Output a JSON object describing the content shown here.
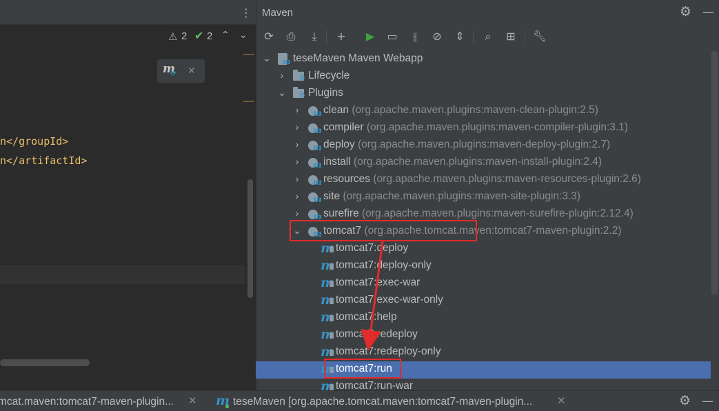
{
  "editor": {
    "warnings_count": "2",
    "checks_count": "2",
    "code_lines": [
      "n</groupId>",
      "n</artifactId>"
    ],
    "icons": [
      "more-vertical-icon",
      "warning-icon",
      "check-icon",
      "chevron-up-icon",
      "chevron-down-icon",
      "maven-reload-icon",
      "close-icon"
    ]
  },
  "maven": {
    "title": "Maven",
    "toolbar_icons": [
      "reload-all-icon",
      "add-sources-icon",
      "download-icon",
      "add-project-icon",
      "run-icon",
      "execute-goal-icon",
      "toggle-offline-icon",
      "skip-tests-icon",
      "collapse-all-icon",
      "analyze-dependencies-icon",
      "show-diagram-icon",
      "settings-wrench-icon"
    ],
    "tree": [
      {
        "label": "teseMaven Maven Webapp",
        "coord": "",
        "arrow": "⌄",
        "icon": "project"
      },
      {
        "label": "Lifecycle",
        "coord": "",
        "arrow": "›",
        "icon": "folder"
      },
      {
        "label": "Plugins",
        "coord": "",
        "arrow": "⌄",
        "icon": "folder"
      },
      {
        "label": "clean",
        "coord": "(org.apache.maven.plugins:maven-clean-plugin:2.5)",
        "arrow": "›",
        "icon": "plugin"
      },
      {
        "label": "compiler",
        "coord": "(org.apache.maven.plugins:maven-compiler-plugin:3.1)",
        "arrow": "›",
        "icon": "plugin"
      },
      {
        "label": "deploy",
        "coord": "(org.apache.maven.plugins:maven-deploy-plugin:2.7)",
        "arrow": "›",
        "icon": "plugin"
      },
      {
        "label": "install",
        "coord": "(org.apache.maven.plugins:maven-install-plugin:2.4)",
        "arrow": "›",
        "icon": "plugin"
      },
      {
        "label": "resources",
        "coord": "(org.apache.maven.plugins:maven-resources-plugin:2.6)",
        "arrow": "›",
        "icon": "plugin"
      },
      {
        "label": "site",
        "coord": "(org.apache.maven.plugins:maven-site-plugin:3.3)",
        "arrow": "›",
        "icon": "plugin"
      },
      {
        "label": "surefire",
        "coord": "(org.apache.maven.plugins:maven-surefire-plugin:2.12.4)",
        "arrow": "›",
        "icon": "plugin"
      },
      {
        "label": "tomcat7",
        "coord": "(org.apache.tomcat.maven:tomcat7-maven-plugin:2.2)",
        "arrow": "⌄",
        "icon": "plugin"
      },
      {
        "label": "tomcat7:deploy",
        "coord": "",
        "arrow": "",
        "icon": "goal"
      },
      {
        "label": "tomcat7:deploy-only",
        "coord": "",
        "arrow": "",
        "icon": "goal"
      },
      {
        "label": "tomcat7:exec-war",
        "coord": "",
        "arrow": "",
        "icon": "goal"
      },
      {
        "label": "tomcat7:exec-war-only",
        "coord": "",
        "arrow": "",
        "icon": "goal"
      },
      {
        "label": "tomcat7:help",
        "coord": "",
        "arrow": "",
        "icon": "goal"
      },
      {
        "label": "tomcat7:redeploy",
        "coord": "",
        "arrow": "",
        "icon": "goal"
      },
      {
        "label": "tomcat7:redeploy-only",
        "coord": "",
        "arrow": "",
        "icon": "goal"
      },
      {
        "label": "tomcat7:run",
        "coord": "",
        "arrow": "",
        "icon": "goal",
        "selected": true
      },
      {
        "label": "tomcat7:run-war",
        "coord": "",
        "arrow": "",
        "icon": "goal"
      }
    ]
  },
  "run_tabs": [
    {
      "label": "mcat.maven:tomcat7-maven-plugin..."
    },
    {
      "label": "teseMaven [org.apache.tomcat.maven:tomcat7-maven-plugin..."
    }
  ],
  "colors": {
    "selection": "#4b6eaf",
    "annotation_red": "#e32b2b",
    "maven_blue": "#3592c4",
    "run_green": "#3fa33f"
  }
}
